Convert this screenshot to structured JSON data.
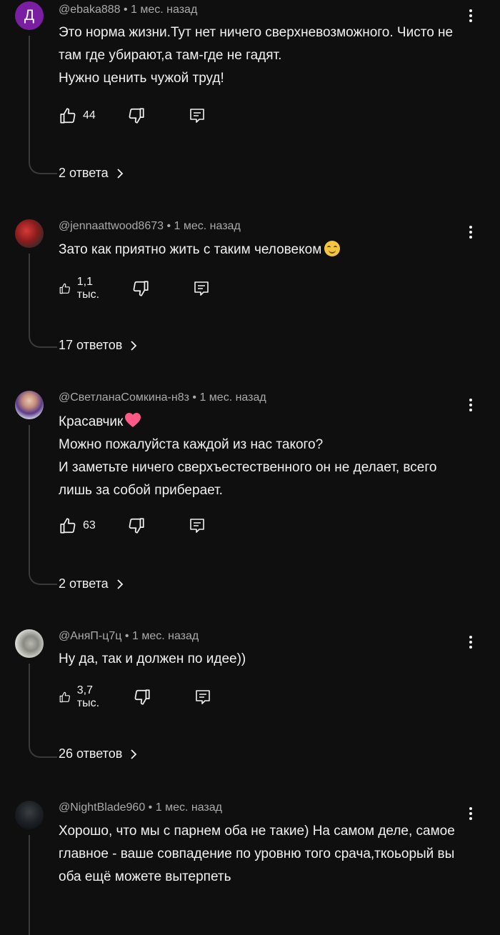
{
  "comments": [
    {
      "author": "@ebaka888",
      "time": "1 мес. назад",
      "avatar_letter": "Д",
      "lines": [
        "Это норма жизни.Тут нет ничего сверхневозможного. Чисто не",
        "там где убирают,а там-где не гадят.",
        "Нужно ценить чужой труд!"
      ],
      "likes": "44",
      "replies": "2 ответа"
    },
    {
      "author": "@jennaattwood8673",
      "time": "1 мес. назад",
      "lines": [
        "Зато как приятно жить с таким человеком"
      ],
      "likes": "1,1 тыс.",
      "replies": "17 ответов"
    },
    {
      "author": "@СветланаСомкина-н8з",
      "time": "1 мес. назад",
      "lines": [
        "Красавчик",
        "Можно пожалуйста каждой из нас такого?",
        "И заметьте ничего сверхъестественного он не делает, всего",
        "лишь за собой приберает."
      ],
      "likes": "63",
      "replies": "2 ответа"
    },
    {
      "author": "@АняП-ц7ц",
      "time": "1 мес. назад",
      "lines": [
        "Ну да, так и должен по идее))"
      ],
      "likes": "3,7 тыс.",
      "replies": "26 ответов"
    },
    {
      "author": "@NightBlade960",
      "time": "1 мес. назад",
      "lines": [
        "Хорошо, что мы с парнем оба не такие) На самом деле, самое",
        "главное - ваше совпадение по уровню того срача,ткоьорый вы",
        "оба ещё можете вытерпеть"
      ]
    }
  ],
  "icons": {
    "like": "thumb-up-icon",
    "dislike": "thumb-down-icon",
    "reply": "reply-icon",
    "more": "more-vert-icon",
    "chevron": "chevron-right-icon"
  },
  "colors": {
    "background": "#0f0f0f",
    "text": "#f1f1f1",
    "meta": "#aaaaaa",
    "letter_avatar": "#7a1fa2"
  }
}
